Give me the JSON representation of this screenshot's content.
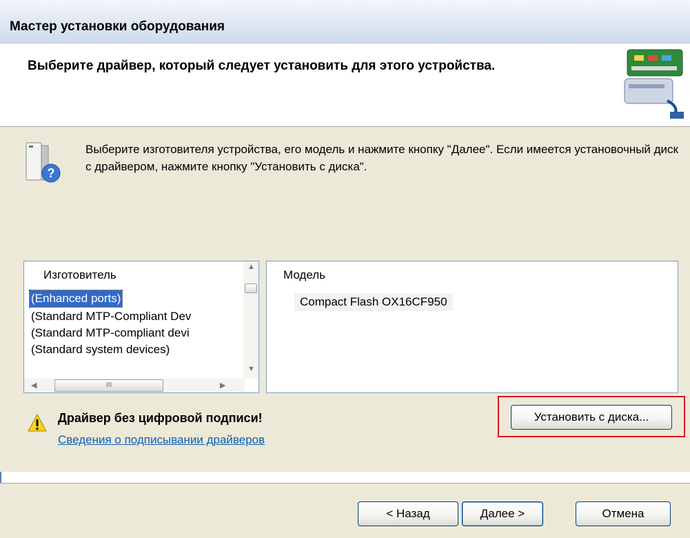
{
  "window": {
    "title": "Мастер установки оборудования"
  },
  "header": {
    "title": "Выберите драйвер, который следует установить для этого устройства."
  },
  "info": {
    "text": "Выберите изготовителя устройства, его модель и нажмите кнопку \"Далее\". Если имеется установочный диск с  драйвером, нажмите кнопку \"Установить с диска\"."
  },
  "manufacturer": {
    "header": "Изготовитель",
    "items": [
      "(Enhanced ports)",
      "(Standard MTP-Compliant Dev",
      "(Standard MTP-compliant devi",
      "(Standard system devices)"
    ],
    "selected": "(Enhanced ports)"
  },
  "model": {
    "header": "Модель",
    "items": [
      "Compact Flash OX16CF950"
    ]
  },
  "scrollbar": {
    "thumb_glyph": "III"
  },
  "warning": {
    "text": "Драйвер без цифровой подписи!",
    "link": "Сведения о подписывании драйверов"
  },
  "buttons": {
    "install": "Установить с диска...",
    "back": "< Назад",
    "next": "Далее >",
    "cancel": "Отмена"
  },
  "colors": {
    "selection": "#316ac5",
    "link": "#0b5fb5",
    "highlight_box": "#e0141e"
  }
}
